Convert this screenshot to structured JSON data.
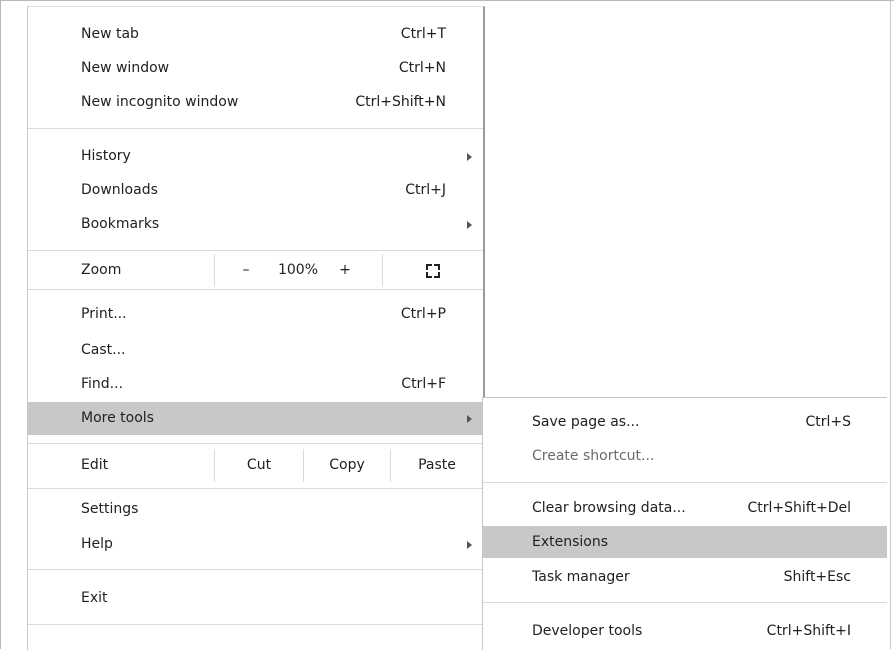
{
  "menu": {
    "new_tab": {
      "label": "New tab",
      "shortcut": "Ctrl+T"
    },
    "new_window": {
      "label": "New window",
      "shortcut": "Ctrl+N"
    },
    "new_incognito": {
      "label": "New incognito window",
      "shortcut": "Ctrl+Shift+N"
    },
    "history": {
      "label": "History"
    },
    "downloads": {
      "label": "Downloads",
      "shortcut": "Ctrl+J"
    },
    "bookmarks": {
      "label": "Bookmarks"
    },
    "zoom": {
      "label": "Zoom",
      "minus": "–",
      "value": "100%",
      "plus": "+",
      "fullscreen_icon": "fullscreen-icon"
    },
    "print": {
      "label": "Print...",
      "shortcut": "Ctrl+P"
    },
    "cast": {
      "label": "Cast..."
    },
    "find": {
      "label": "Find...",
      "shortcut": "Ctrl+F"
    },
    "more_tools": {
      "label": "More tools"
    },
    "edit": {
      "label": "Edit",
      "cut": "Cut",
      "copy": "Copy",
      "paste": "Paste"
    },
    "settings": {
      "label": "Settings"
    },
    "help": {
      "label": "Help"
    },
    "exit": {
      "label": "Exit"
    }
  },
  "submenu": {
    "save_page": {
      "label": "Save page as...",
      "shortcut": "Ctrl+S"
    },
    "create_shortcut": {
      "label": "Create shortcut..."
    },
    "clear_browsing": {
      "label": "Clear browsing data...",
      "shortcut": "Ctrl+Shift+Del"
    },
    "extensions": {
      "label": "Extensions"
    },
    "task_manager": {
      "label": "Task manager",
      "shortcut": "Shift+Esc"
    },
    "developer_tools": {
      "label": "Developer tools",
      "shortcut": "Ctrl+Shift+I"
    }
  },
  "colors": {
    "hover": "#c8c8c8",
    "text": "#202124",
    "disabled": "#6b6b6b",
    "separator": "#dadada"
  }
}
